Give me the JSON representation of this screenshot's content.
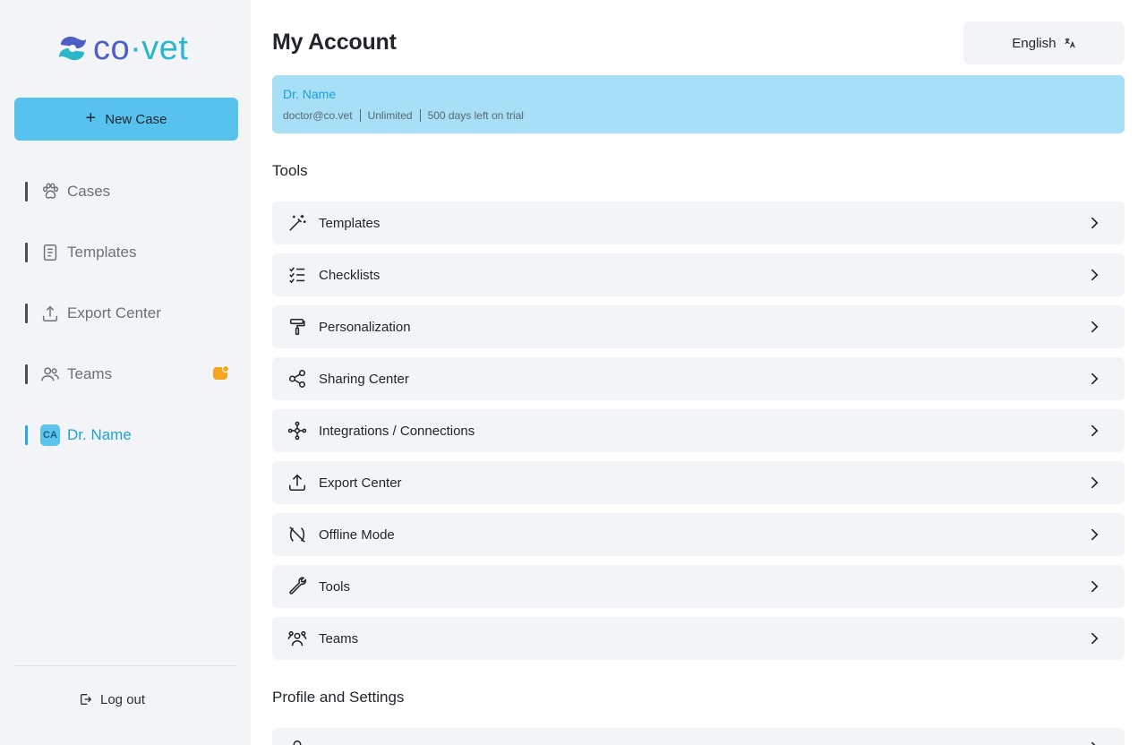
{
  "brand": {
    "logo_name": "co-vet-logo",
    "text_prefix": "co",
    "text_dot": "·",
    "text_suffix": "vet"
  },
  "sidebar": {
    "new_case_label": "New Case",
    "items": [
      {
        "label": "Cases",
        "icon": "paw-icon",
        "active": false
      },
      {
        "label": "Templates",
        "icon": "document-icon",
        "active": false
      },
      {
        "label": "Export Center",
        "icon": "upload-icon",
        "active": false
      },
      {
        "label": "Teams",
        "icon": "users-icon",
        "active": false,
        "badge": true
      },
      {
        "label": "Dr. Name",
        "icon": "avatar",
        "avatar_initials": "CA",
        "active": true
      }
    ],
    "logout_label": "Log out"
  },
  "header": {
    "title": "My Account",
    "language": "English"
  },
  "account": {
    "name": "Dr. Name",
    "email": "doctor@co.vet",
    "plan": "Unlimited",
    "trial": "500 days left on trial"
  },
  "sections": {
    "tools_title": "Tools",
    "profile_title": "Profile and Settings"
  },
  "tools": [
    {
      "label": "Templates",
      "icon": "magic-wand-icon"
    },
    {
      "label": "Checklists",
      "icon": "checklist-icon"
    },
    {
      "label": "Personalization",
      "icon": "paint-roller-icon"
    },
    {
      "label": "Sharing Center",
      "icon": "share-icon"
    },
    {
      "label": "Integrations / Connections",
      "icon": "network-icon"
    },
    {
      "label": "Export Center",
      "icon": "upload-icon"
    },
    {
      "label": "Offline Mode",
      "icon": "offline-icon"
    },
    {
      "label": "Tools",
      "icon": "wrench-icon"
    },
    {
      "label": "Teams",
      "icon": "team-icon"
    }
  ],
  "colors": {
    "accent": "#58c2ef",
    "active_text": "#1f9fd8",
    "account_card": "#a6dff6",
    "row_bg": "#f3f4f7",
    "badge": "#f5a623"
  }
}
